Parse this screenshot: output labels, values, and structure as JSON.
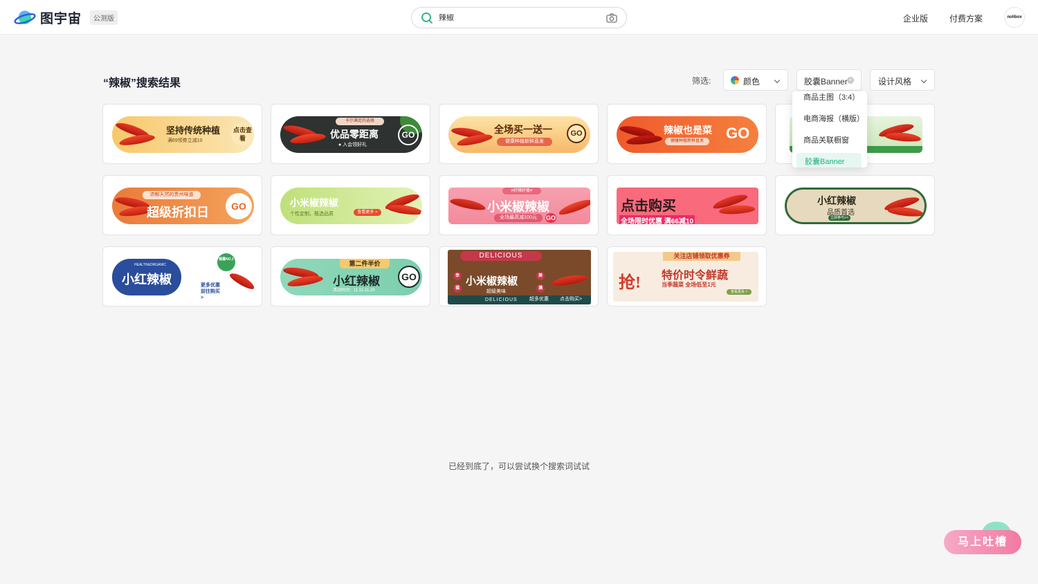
{
  "header": {
    "logo_text": "图宇宙",
    "beta_badge": "公测版",
    "search": {
      "value": "辣椒"
    },
    "nav": {
      "enterprise": "企业版",
      "pricing": "付费方案"
    },
    "avatar_text": "nolibox"
  },
  "toolbar": {
    "title": "“辣椒”搜索结果",
    "filter_label": "筛选:",
    "color_filter": "颜色",
    "type_filter": "胶囊Banner",
    "style_filter": "设计风格"
  },
  "dropdown": {
    "items": [
      "商品主图（3:4）",
      "电商海报（横版）",
      "商品关联橱窗",
      "胶囊Banner"
    ],
    "selected": "胶囊Banner"
  },
  "cards": [
    {
      "main": "坚持传统种植",
      "sub": "满69领券立减10",
      "cta": "点击查看"
    },
    {
      "top": "卡尔满足的选择",
      "main": "优品零距离",
      "sub": "● 入会领好礼",
      "cta": "GO"
    },
    {
      "main": "全场买一送一",
      "sub": "健康种植新鲜直发",
      "cta": "GO"
    },
    {
      "main": "辣椒也是菜",
      "sub": "健康种植新鲜直发",
      "cta": "GO"
    },
    {
      "main": "",
      "sub": "",
      "cta": ""
    },
    {
      "top": "浓郁天然的贵州味道",
      "main": "超级折扣日",
      "cta": "GO"
    },
    {
      "main": "小米椒辣椒",
      "sub": "个性定制，甄选品质",
      "cta": "查看更多 >"
    },
    {
      "top": "#好辣好香#",
      "main": "小米椒辣椒",
      "sub": "全场最高减100元",
      "cta": "GO"
    },
    {
      "main": "点击购买",
      "sub": "全场限时优惠 满66减10"
    },
    {
      "main": "小红辣椒",
      "sub": "品质首选",
      "cta": "立即参与>>"
    },
    {
      "top": "HEALTH&ORGANIC",
      "main": "小红辣椒",
      "sub": "更多优惠 前往购买>",
      "badge": "销量NO.1"
    },
    {
      "top": "第二件半价",
      "main": "小红辣椒",
      "sub": "活动时间：11.11-11.20",
      "cta": "GO"
    },
    {
      "top": "DELICIOUS",
      "main": "小米椒辣椒",
      "sub": "超级美味",
      "footer": [
        "DELICIOUS",
        "超多优惠",
        "点击购买>"
      ],
      "side": [
        "幸",
        "福",
        "美",
        "满"
      ]
    },
    {
      "top": "关注店铺领取优惠券",
      "side": "抢!",
      "main": "特价时令鲜蔬",
      "sub": "当季蔬菜 全场低至1元",
      "cta": "查看更多 >"
    }
  ],
  "footer_text": "已经到底了，可以尝试换个搜索词试试",
  "feedback_button": "马上吐槽",
  "colors": {
    "accent": "#22b07d",
    "feedback": "#f27aa3"
  }
}
